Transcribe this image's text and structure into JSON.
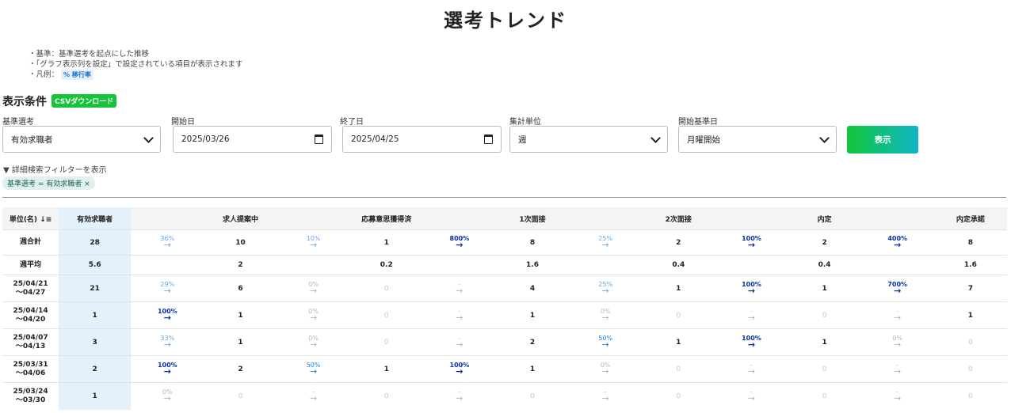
{
  "title": "選考トレンド",
  "notes": [
    "・基準：基準選考を起点にした推移",
    "・「グラフ表示列を設定」で設定されている項目が表示されます"
  ],
  "legend_prefix": "・凡例：",
  "legend_badge": "% 移行率",
  "condition_title": "表示条件",
  "csv_button": "CSVダウンロード",
  "filters": {
    "base_label": "基準選考",
    "base_value": "有効求職者",
    "start_label": "開始日",
    "start_value": "2025/03/26",
    "end_label": "終了日",
    "end_value": "2025/04/25",
    "unit_label": "集計単位",
    "unit_value": "週",
    "weekstart_label": "開始基準日",
    "weekstart_value": "月曜開始"
  },
  "show_button": "表示",
  "filter_toggle": "▼ 詳細検索フィルターを表示",
  "active_chip": "基準選考 = 有効求職者 ×",
  "table": {
    "unit_header": "単位(名)",
    "columns": [
      "有効求職者",
      "求人提案中",
      "応募意思獲得済",
      "1次面接",
      "2次面接",
      "内定",
      "内定承諾"
    ],
    "summary": [
      {
        "label": "週合計",
        "values": [
          "28",
          "10",
          "1",
          "8",
          "2",
          "2",
          "8"
        ],
        "rates": [
          "36%",
          "10%",
          "800%",
          "25%",
          "100%",
          "400%"
        ]
      },
      {
        "label": "週平均",
        "values": [
          "5.6",
          "2",
          "0.2",
          "1.6",
          "0.4",
          "0.4",
          "1.6"
        ],
        "rates": [
          "",
          "",
          "",
          "",
          "",
          ""
        ]
      }
    ],
    "rows": [
      {
        "from": "25/04/21",
        "to": "～04/27",
        "values": [
          "21",
          "6",
          "0",
          "4",
          "1",
          "1",
          "7"
        ],
        "rates": [
          "29%",
          "0%",
          "-",
          "25%",
          "100%",
          "700%"
        ]
      },
      {
        "from": "25/04/14",
        "to": "～04/20",
        "values": [
          "1",
          "1",
          "0",
          "1",
          "0",
          "0",
          "1"
        ],
        "rates": [
          "100%",
          "0%",
          "-",
          "0%",
          "-",
          "-"
        ]
      },
      {
        "from": "25/04/07",
        "to": "～04/13",
        "values": [
          "3",
          "1",
          "0",
          "2",
          "1",
          "1",
          "0"
        ],
        "rates": [
          "33%",
          "0%",
          "-",
          "50%",
          "100%",
          "0%"
        ]
      },
      {
        "from": "25/03/31",
        "to": "～04/06",
        "values": [
          "2",
          "2",
          "1",
          "1",
          "0",
          "0",
          "0"
        ],
        "rates": [
          "100%",
          "50%",
          "100%",
          "0%",
          "-",
          "-"
        ]
      },
      {
        "from": "25/03/24",
        "to": "～03/30",
        "values": [
          "1",
          "0",
          "0",
          "0",
          "0",
          "0",
          "0"
        ],
        "rates": [
          "0%",
          "-",
          "-",
          "-",
          "-",
          "-"
        ]
      }
    ]
  }
}
